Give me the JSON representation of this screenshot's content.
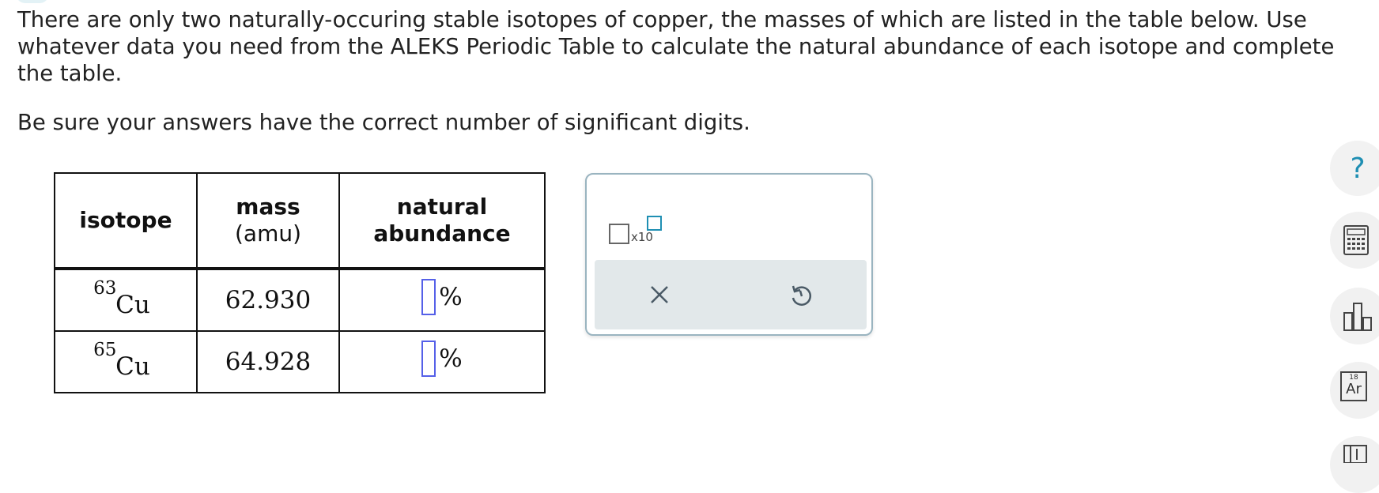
{
  "question": {
    "paragraph1": "There are only two naturally-occuring stable isotopes of copper, the masses of which are listed in the table below. Use whatever data you need from the ALEKS Periodic Table to calculate the natural abundance of each isotope and complete the table.",
    "paragraph2": "Be sure your answers have the correct number of significant digits."
  },
  "table": {
    "headers": {
      "isotope": "isotope",
      "mass": "mass",
      "mass_unit": "(amu)",
      "abundance_line1": "natural",
      "abundance_line2": "abundance"
    },
    "rows": [
      {
        "mass_number": "63",
        "symbol": "Cu",
        "mass": "62.930",
        "abundance": "",
        "unit": "%"
      },
      {
        "mass_number": "65",
        "symbol": "Cu",
        "mass": "64.928",
        "abundance": "",
        "unit": "%"
      }
    ]
  },
  "palette": {
    "sci_label": "x10",
    "icons": {
      "clear": "close-icon",
      "undo": "undo-icon"
    }
  },
  "side_tools": {
    "help_label": "?",
    "periodic_number": "18",
    "periodic_symbol": "Ar",
    "icons": [
      "help-icon",
      "calculator-icon",
      "bar-chart-icon",
      "periodic-table-icon",
      "textbook-icon"
    ]
  },
  "colors": {
    "accent": "#1f8fb3",
    "answer_box_border": "#5560e8",
    "palette_border": "#9ab4c0",
    "action_bar": "#e2e8ea"
  }
}
